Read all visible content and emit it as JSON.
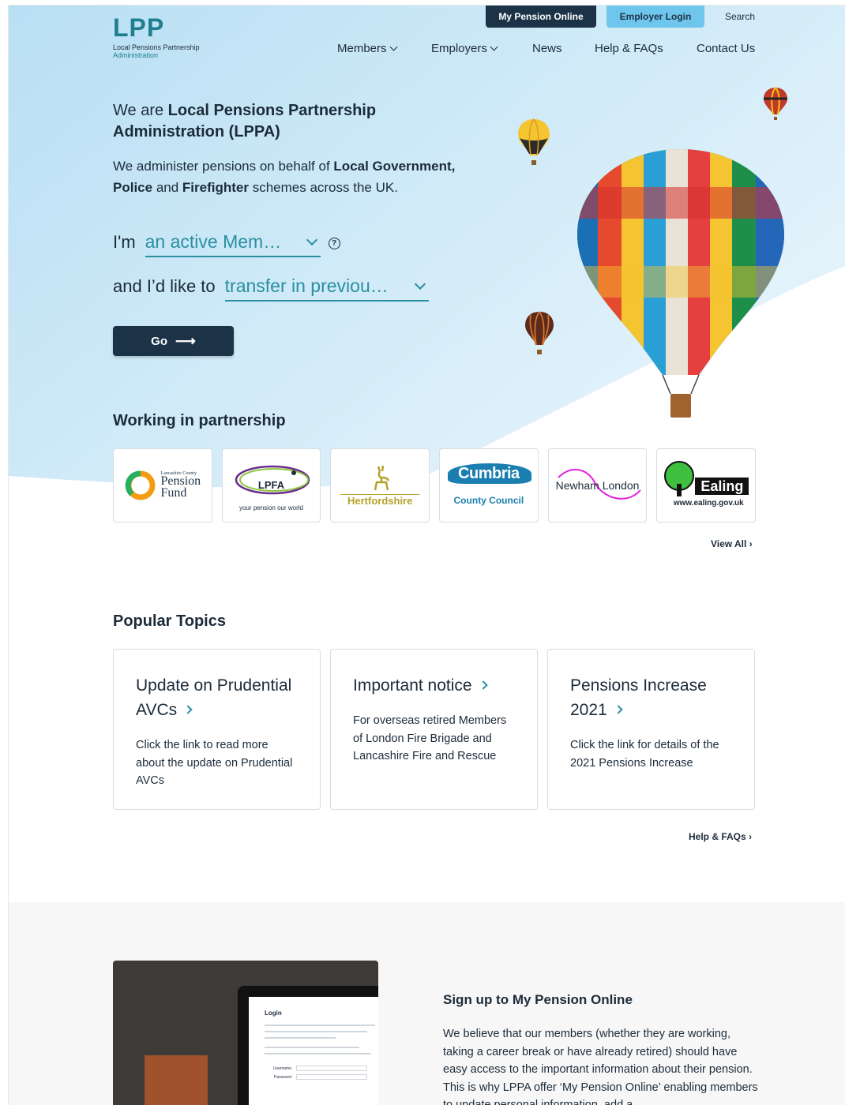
{
  "header": {
    "logo_mark": "LPP",
    "logo_line1": "Local Pensions Partnership",
    "logo_line2": "Administration",
    "my_pension_online": "My Pension Online",
    "employer_login": "Employer Login",
    "search": "Search"
  },
  "nav": {
    "items": [
      {
        "label": "Members",
        "dropdown": true
      },
      {
        "label": "Employers",
        "dropdown": true
      },
      {
        "label": "News",
        "dropdown": false
      },
      {
        "label": "Help & FAQs",
        "dropdown": false
      },
      {
        "label": "Contact Us",
        "dropdown": false
      }
    ]
  },
  "hero": {
    "title_pre": "We are ",
    "title_bold": "Local Pensions Partnership Administration (LPPA)",
    "desc_1": "We administer pensions on behalf of ",
    "desc_2": "Local Government, Police",
    "desc_3": " and ",
    "desc_4": "Firefighter",
    "desc_5": " schemes across the UK.",
    "role_prefix": "I'm",
    "role_value": "an active Mem…",
    "action_prefix": "and I’d like to",
    "action_value": "transfer in previou…",
    "go_label": "Go",
    "help_glyph": "?"
  },
  "partnership": {
    "title": "Working in partnership",
    "partners": [
      {
        "line1": "Lancashire County",
        "line2": "Pension",
        "line3": "Fund"
      },
      {
        "line1": "LPFA",
        "line2": "your pension our world"
      },
      {
        "line1": "Hertfordshire"
      },
      {
        "line1": "Cumbria",
        "line2": "County Council"
      },
      {
        "line1": "Newham London"
      },
      {
        "line1": "Ealing",
        "line2": "www.ealing.gov.uk"
      }
    ],
    "view_all": "View All"
  },
  "topics": {
    "title": "Popular Topics",
    "cards": [
      {
        "title": "Update on Prudential AVCs",
        "text": "Click the link to read more about the update on Prudential AVCs"
      },
      {
        "title": "Important notice",
        "text": "For overseas retired Members of London Fire Brigade and Lancashire Fire and Rescue"
      },
      {
        "title": "Pensions Increase 2021",
        "text": "Click the link for details of the 2021 Pensions Increase"
      }
    ],
    "help_link": "Help & FAQs"
  },
  "signup": {
    "title": "Sign up to My Pension Online",
    "text": "We believe that our members (whether they are working, taking a career break or have already retired) should have easy access to the important information about their pension. This is why LPPA offer ‘My Pension Online’ enabling members to update personal information, add a",
    "screen_login": "Login",
    "screen_username": "Username",
    "screen_password": "Password"
  },
  "colors": {
    "accent_teal": "#2a8fa0",
    "navy": "#1c3347",
    "employer_blue": "#6fc6ec",
    "hero_sky": "#bfe3f6"
  }
}
